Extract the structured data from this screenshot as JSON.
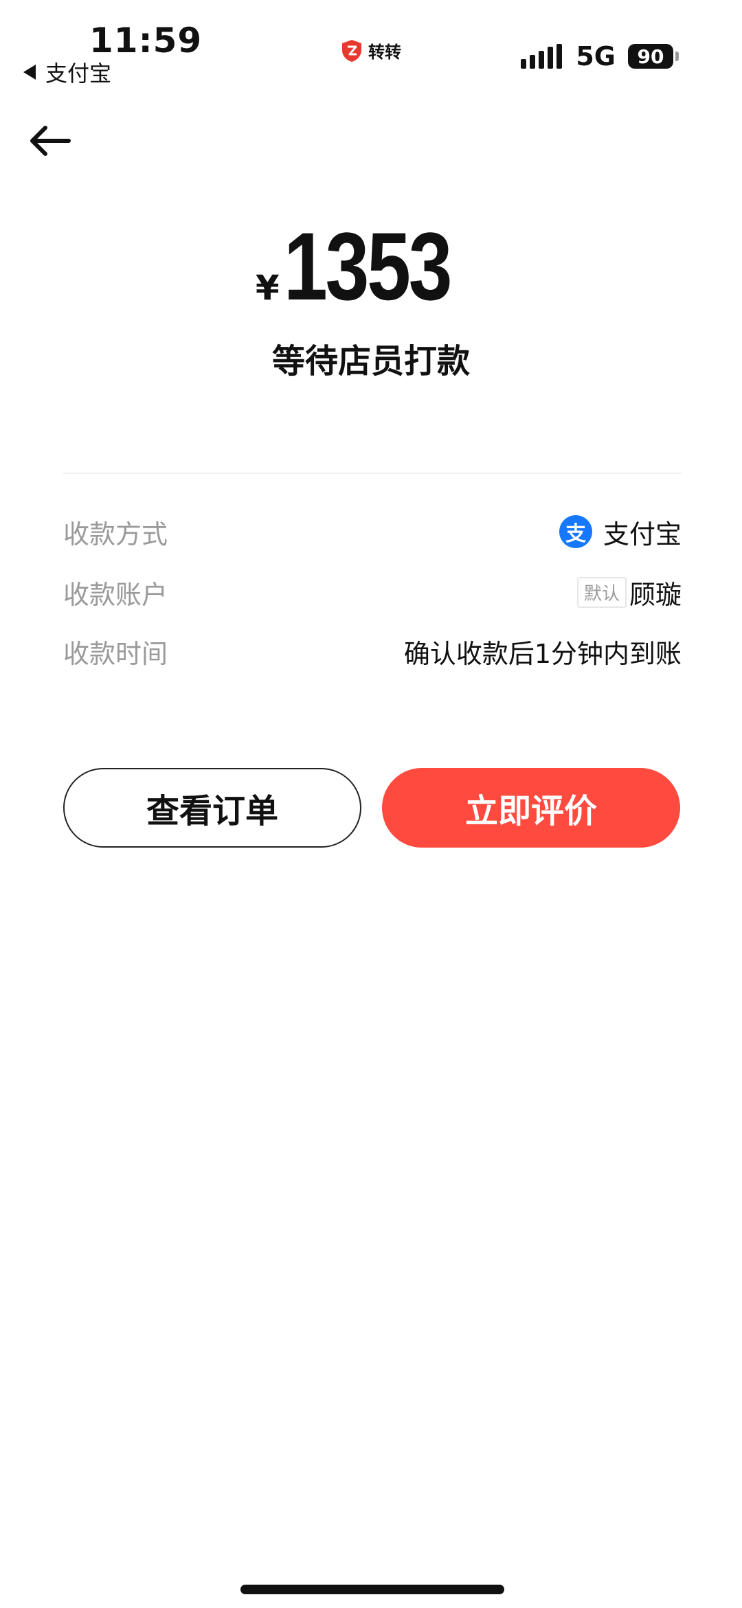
{
  "status_bar": {
    "time": "11:59",
    "back_app": "支付宝",
    "center_app": "转转",
    "network": "5G",
    "battery": "90"
  },
  "payment": {
    "currency": "¥",
    "amount": "1353",
    "status": "等待店员打款"
  },
  "details": [
    {
      "label": "收款方式",
      "value": "支付宝",
      "icon": "alipay-icon"
    },
    {
      "label": "收款账户",
      "tag": "默认",
      "value": "顾璇"
    },
    {
      "label": "收款时间",
      "value": "确认收款后1分钟内到账"
    }
  ],
  "actions": {
    "view_order": "查看订单",
    "review_now": "立即评价"
  },
  "colors": {
    "primary": "#ff4a3f",
    "alipay": "#1677ff",
    "label_gray": "#9a9a9a"
  }
}
